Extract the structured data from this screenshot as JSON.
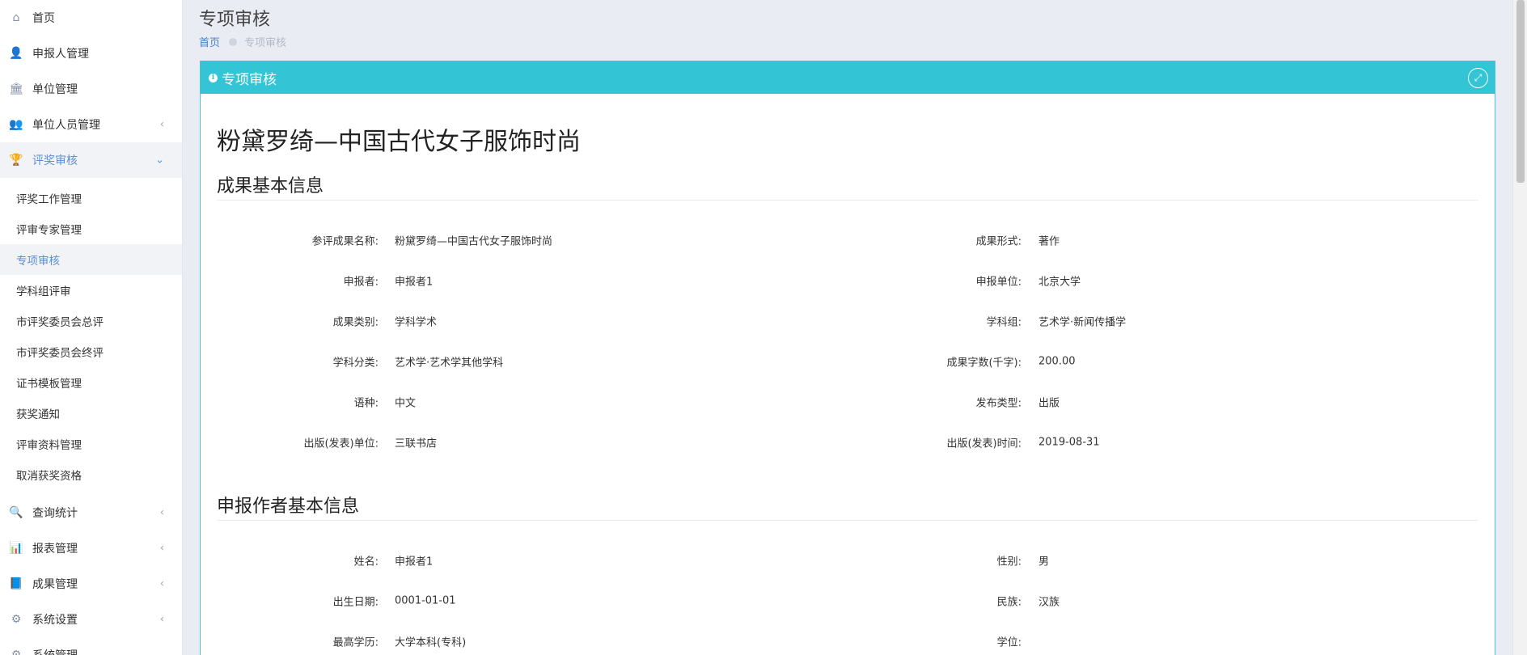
{
  "sidebar": {
    "items": [
      {
        "label": "首页",
        "icon": "home-icon",
        "glyph": "⌂"
      },
      {
        "label": "申报人管理",
        "icon": "user-icon",
        "glyph": "👤"
      },
      {
        "label": "单位管理",
        "icon": "institution-icon",
        "glyph": "🏛"
      },
      {
        "label": "单位人员管理",
        "icon": "users-icon",
        "glyph": "👥",
        "chevron": "‹"
      },
      {
        "label": "评奖审核",
        "icon": "trophy-icon",
        "glyph": "🏆",
        "chevron": "⌄",
        "active": true
      }
    ],
    "sub_items": [
      {
        "label": "评奖工作管理"
      },
      {
        "label": "评审专家管理"
      },
      {
        "label": "专项审核",
        "selected": true
      },
      {
        "label": "学科组评审"
      },
      {
        "label": "市评奖委员会总评"
      },
      {
        "label": "市评奖委员会终评"
      },
      {
        "label": "证书模板管理"
      },
      {
        "label": "获奖通知"
      },
      {
        "label": "评审资料管理"
      },
      {
        "label": "取消获奖资格"
      }
    ],
    "items_after": [
      {
        "label": "查询统计",
        "icon": "search-icon",
        "glyph": "🔍",
        "chevron": "‹"
      },
      {
        "label": "报表管理",
        "icon": "bar-chart-icon",
        "glyph": "📊",
        "chevron": "‹"
      },
      {
        "label": "成果管理",
        "icon": "book-icon",
        "glyph": "📘",
        "chevron": "‹"
      },
      {
        "label": "系统设置",
        "icon": "gears-icon",
        "glyph": "⚙",
        "chevron": "‹"
      },
      {
        "label": "系统管理",
        "icon": "cog-icon",
        "glyph": "⚙"
      }
    ]
  },
  "header": {
    "page_title": "专项审核",
    "breadcrumb_home": "首页",
    "breadcrumb_current": "专项审核"
  },
  "panel": {
    "title": "专项审核",
    "info_glyph": "i",
    "expand_glyph": "⤢"
  },
  "work_title": "粉黛罗绮—中国古代女子服饰时尚",
  "section1": {
    "title": "成果基本信息",
    "rows": [
      {
        "l1": "参评成果名称:",
        "v1": "粉黛罗绮—中国古代女子服饰时尚",
        "l2": "成果形式:",
        "v2": "著作"
      },
      {
        "l1": "申报者:",
        "v1": "申报者1",
        "l2": "申报单位:",
        "v2": "北京大学"
      },
      {
        "l1": "成果类别:",
        "v1": "学科学术",
        "l2": "学科组:",
        "v2": "艺术学·新闻传播学"
      },
      {
        "l1": "学科分类:",
        "v1": "艺术学·艺术学其他学科",
        "l2": "成果字数(千字):",
        "v2": "200.00"
      },
      {
        "l1": "语种:",
        "v1": "中文",
        "l2": "发布类型:",
        "v2": "出版"
      },
      {
        "l1": "出版(发表)单位:",
        "v1": "三联书店",
        "l2": "出版(发表)时间:",
        "v2": "2019-08-31"
      }
    ]
  },
  "section2": {
    "title": "申报作者基本信息",
    "rows": [
      {
        "l1": "姓名:",
        "v1": "申报者1",
        "l2": "性别:",
        "v2": "男"
      },
      {
        "l1": "出生日期:",
        "v1": "0001-01-01",
        "l2": "民族:",
        "v2": "汉族"
      },
      {
        "l1": "最高学历:",
        "v1": "大学本科(专科)",
        "l2": "学位:",
        "v2": ""
      }
    ]
  }
}
